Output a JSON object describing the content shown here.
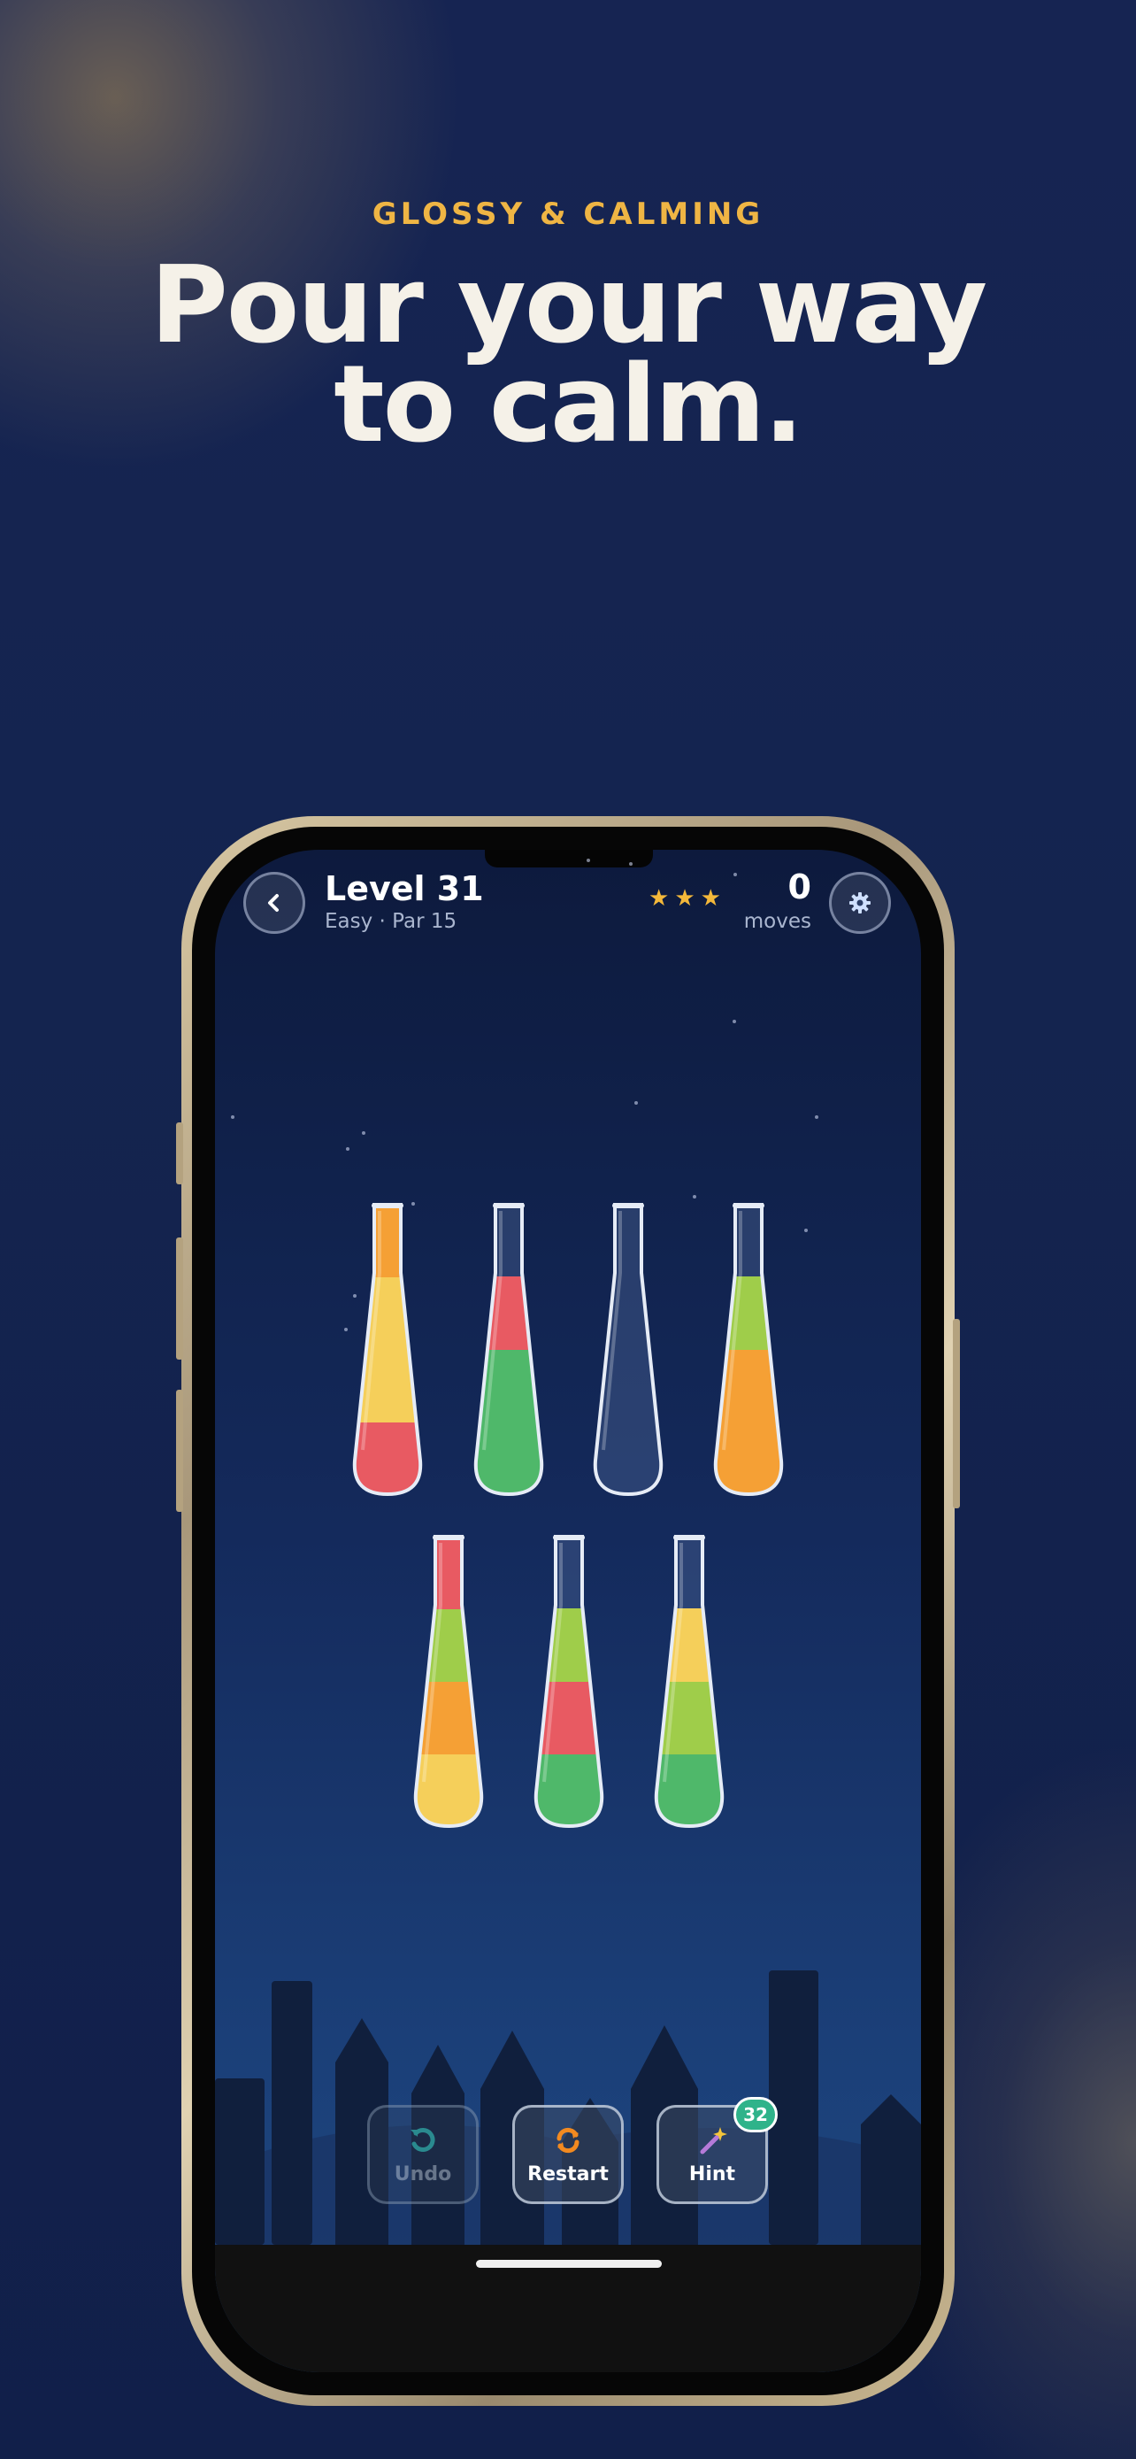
{
  "promo": {
    "eyebrow": "GLOSSY & CALMING",
    "headline_line1": "Pour your way",
    "headline_line2": "to calm."
  },
  "game": {
    "level_title": "Level 31",
    "level_subtitle": "Easy · Par 15",
    "stars_earned": 3,
    "moves_count": "0",
    "moves_label": "moves",
    "colors": {
      "orange": "#f5a035",
      "yellow": "#f5cf5a",
      "red": "#e85a62",
      "green": "#4fb86a",
      "lime": "#9fcd4a"
    },
    "tubes_row1": [
      [
        "red",
        "yellow",
        "yellow",
        "orange"
      ],
      [
        "green",
        "green",
        "red"
      ],
      [],
      [
        "orange",
        "orange",
        "lime"
      ]
    ],
    "tubes_row2": [
      [
        "yellow",
        "orange",
        "lime",
        "red"
      ],
      [
        "green",
        "red",
        "lime"
      ],
      [
        "green",
        "lime",
        "yellow"
      ]
    ],
    "actions": {
      "undo_label": "Undo",
      "restart_label": "Restart",
      "hint_label": "Hint",
      "hint_count": "32"
    }
  }
}
